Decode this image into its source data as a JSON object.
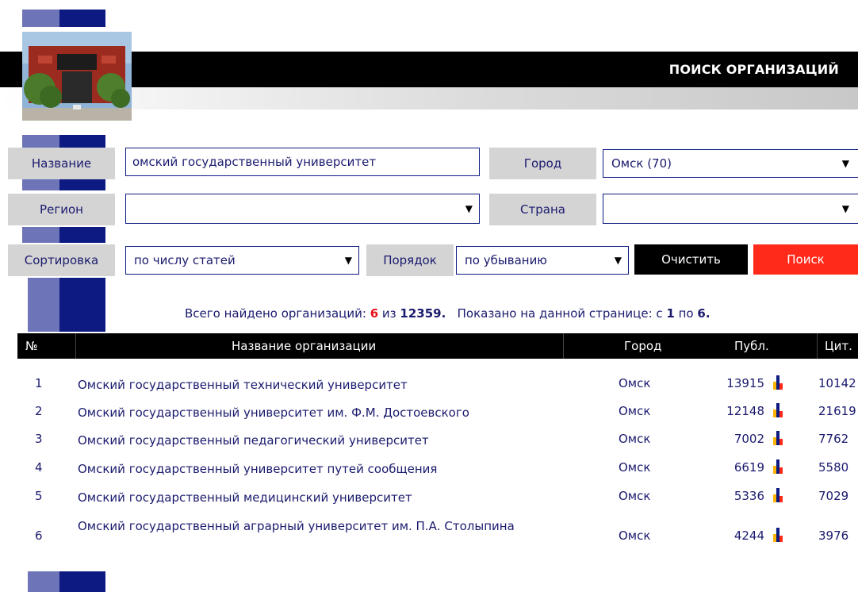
{
  "header": {
    "title": "ПОИСК ОРГАНИЗАЦИЙ"
  },
  "form": {
    "name_label": "Название",
    "name_value": "омский государственный университет",
    "city_label": "Город",
    "city_value": "Омск (70)",
    "region_label": "Регион",
    "region_value": "",
    "country_label": "Страна",
    "country_value": "",
    "sort_label": "Сортировка",
    "sort_value": "по числу статей",
    "order_label": "Порядок",
    "order_value": "по убыванию",
    "clear_button": "Очистить",
    "search_button": "Поиск"
  },
  "summary": {
    "prefix": "Всего найдено организаций: ",
    "found": "6",
    "of": " из ",
    "total": "12359.",
    "shown_prefix": "   Показано на данной странице: с ",
    "from": "1",
    "to_word": " по ",
    "to": "6."
  },
  "table": {
    "headers": {
      "num": "№",
      "name": "Название организации",
      "city": "Город",
      "publ": "Публ.",
      "cit": "Цит."
    },
    "rows": [
      {
        "num": "1",
        "name": "Омский государственный технический университет",
        "city": "Омск",
        "publ": "13915",
        "cit": "10142"
      },
      {
        "num": "2",
        "name": "Омский государственный университет им. Ф.М. Достоевского",
        "city": "Омск",
        "publ": "12148",
        "cit": "21619"
      },
      {
        "num": "3",
        "name": "Омский государственный педагогический университет",
        "city": "Омск",
        "publ": "7002",
        "cit": "7762"
      },
      {
        "num": "4",
        "name": "Омский государственный университет путей сообщения",
        "city": "Омск",
        "publ": "6619",
        "cit": "5580"
      },
      {
        "num": "5",
        "name": "Омский государственный медицинский университет",
        "city": "Омск",
        "publ": "5336",
        "cit": "7029"
      },
      {
        "num": "6",
        "name": "Омский государственный аграрный университет им. П.А. Столыпина",
        "city": "Омск",
        "publ": "4244",
        "cit": "3976"
      }
    ]
  },
  "icons": {
    "chart": "bar-chart-icon",
    "dropdown": "dropdown-arrow-icon"
  },
  "colors": {
    "dark_blue": "#0c1a82",
    "light_blue": "#6e74b8",
    "red": "#ff2a1a",
    "black": "#000000"
  }
}
